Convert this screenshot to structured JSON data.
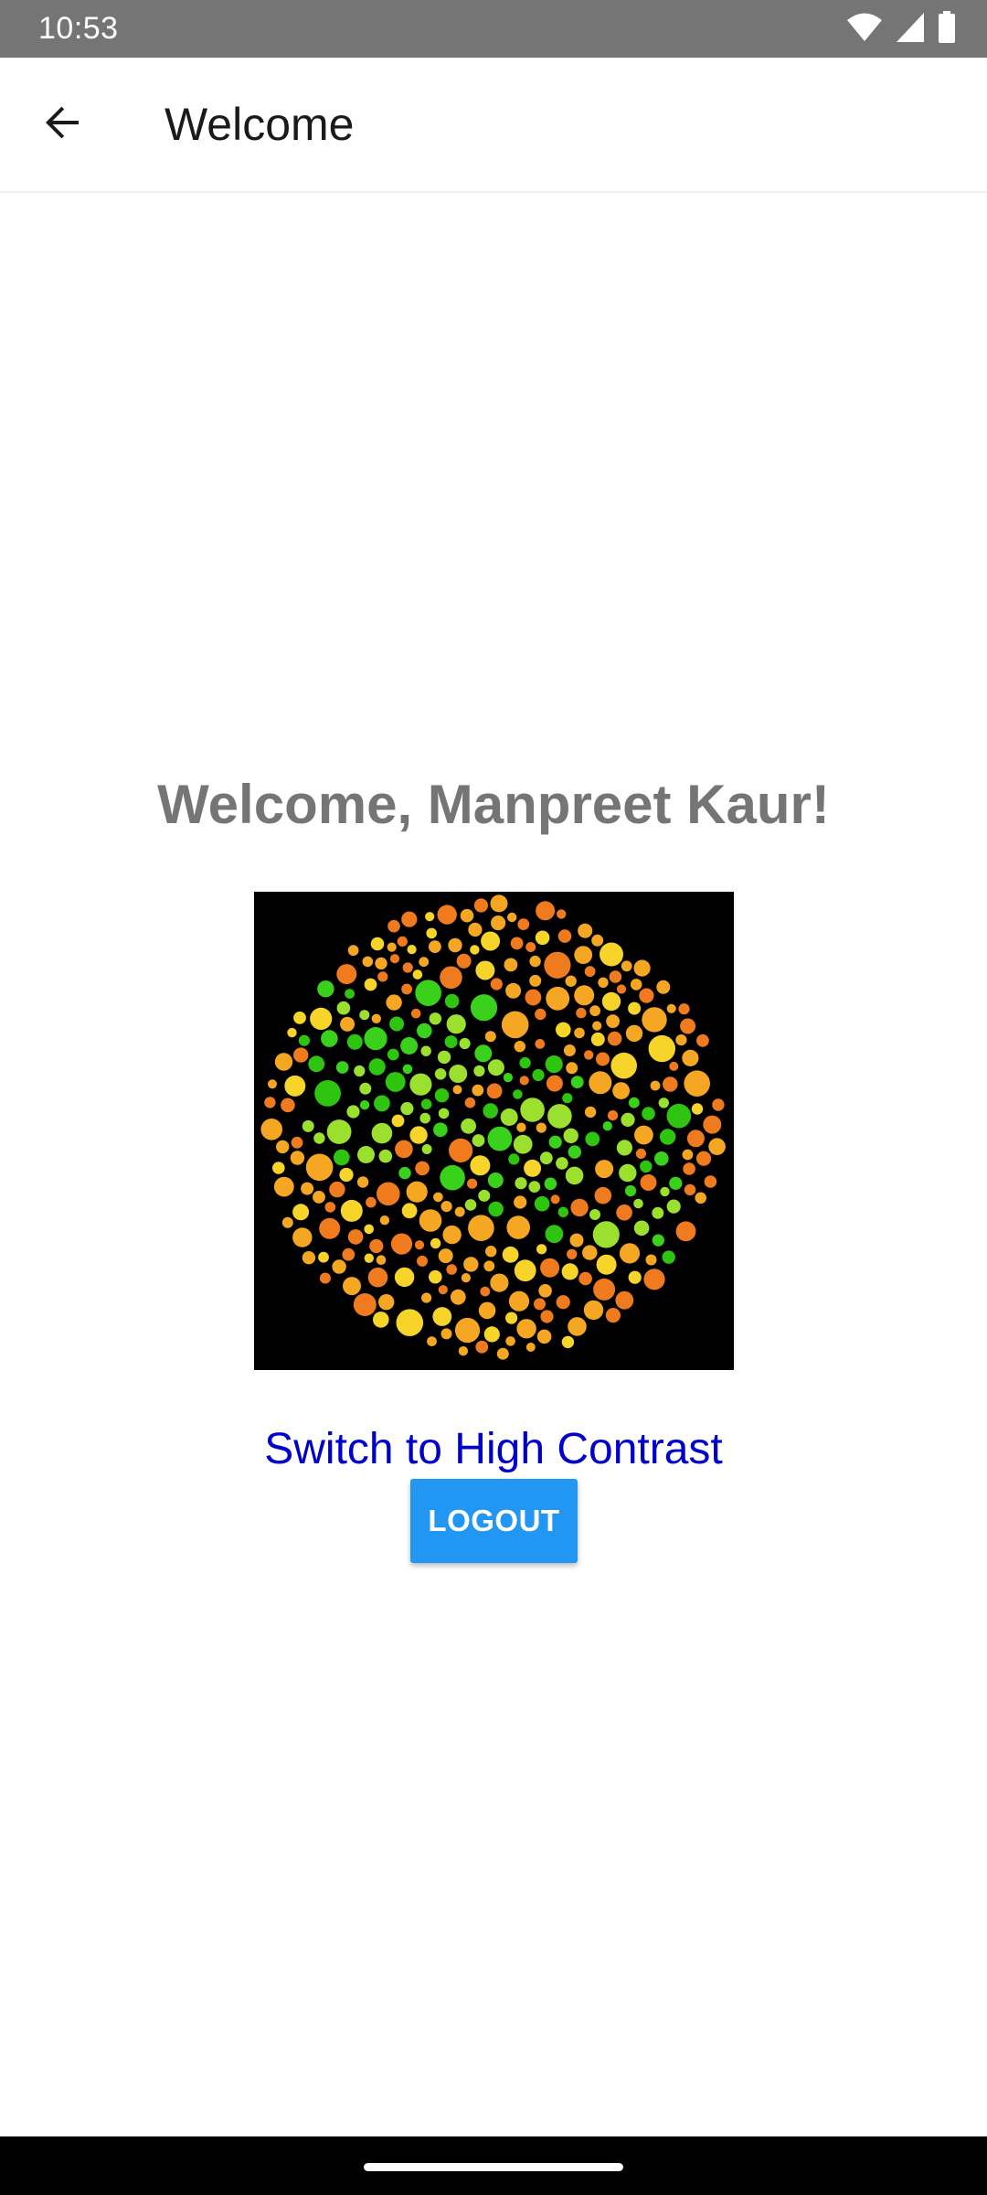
{
  "status_bar": {
    "time": "10:53",
    "icons": [
      "wifi-icon",
      "signal-icon",
      "battery-icon"
    ]
  },
  "app_bar": {
    "back_icon": "arrow-back-icon",
    "title": "Welcome"
  },
  "main": {
    "welcome_text": "Welcome, Manpreet Kaur!",
    "image": {
      "kind": "color-blindness-test-plate",
      "colors": [
        "#f07a1e",
        "#f5a623",
        "#f6d42a",
        "#9be02f",
        "#3ad11c",
        "#2ec40f"
      ]
    },
    "contrast_link": "Switch to High Contrast",
    "logout_label": "LOGOUT"
  },
  "colors": {
    "status_bar": "#757575",
    "heading": "#757575",
    "link": "#0000cc",
    "button": "#2196f3"
  }
}
